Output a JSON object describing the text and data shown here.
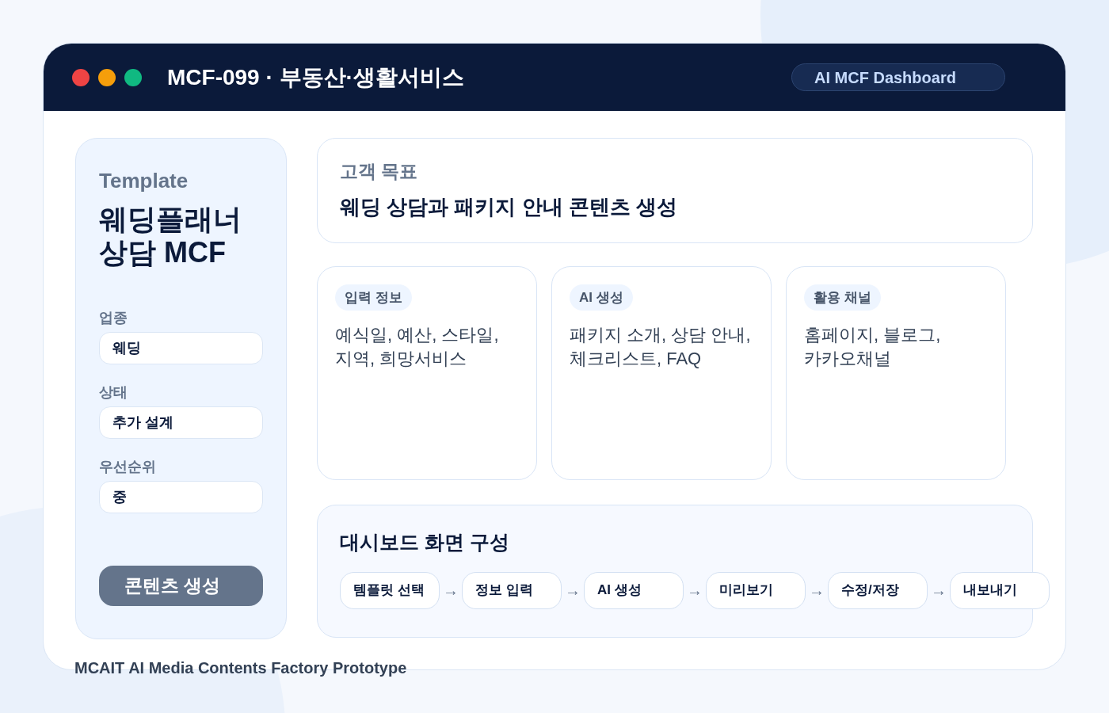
{
  "window": {
    "title": "MCF-099 · 부동산·생활서비스",
    "badge": "AI MCF Dashboard"
  },
  "sidebar": {
    "eyebrow": "Template",
    "title_lines": [
      "웨딩플래너",
      "상담 MCF"
    ],
    "fields": [
      {
        "label": "업종",
        "value": "웨딩"
      },
      {
        "label": "상태",
        "value": "추가 설계"
      },
      {
        "label": "우선순위",
        "value": "중"
      }
    ],
    "button": "콘텐츠 생성"
  },
  "goal": {
    "label": "고객 목표",
    "text": "웨딩 상담과 패키지 안내 콘텐츠 생성"
  },
  "cards": [
    {
      "tag": "입력 정보",
      "lines": [
        "예식일, 예산, 스타일,",
        "지역, 희망서비스"
      ]
    },
    {
      "tag": "AI 생성",
      "lines": [
        "패키지 소개, 상담 안내,",
        "체크리스트, FAQ"
      ]
    },
    {
      "tag": "활용 채널",
      "lines": [
        "홈페이지, 블로그,",
        "카카오채널"
      ]
    }
  ],
  "flow": {
    "title": "대시보드 화면 구성",
    "arrow": "→",
    "steps": [
      "템플릿 선택",
      "정보 입력",
      "AI 생성",
      "미리보기",
      "수정/저장",
      "내보내기"
    ]
  },
  "footer": "MCAIT AI Media Contents Factory Prototype"
}
